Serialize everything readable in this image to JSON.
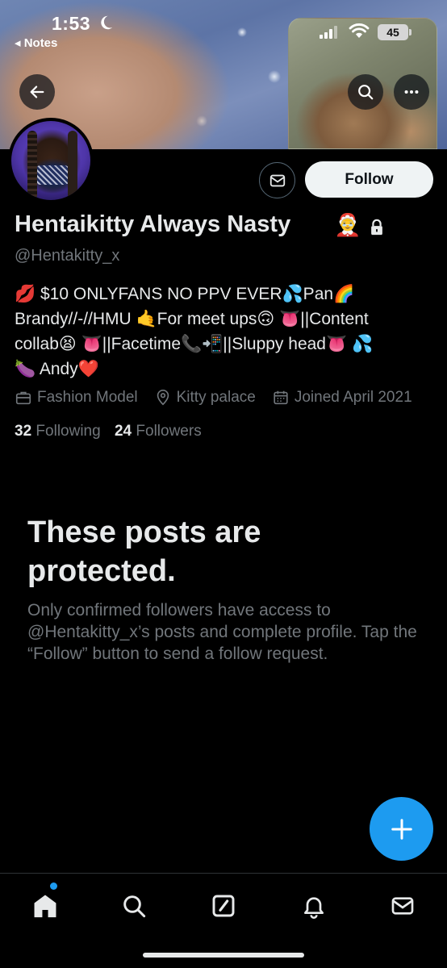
{
  "status_bar": {
    "time": "1:53",
    "back_app": "◂ Notes",
    "battery": "45"
  },
  "profile": {
    "display_name": "Hentaikitty Always Nasty",
    "name_emoji": "🤶",
    "handle": "@Hentakitty_x",
    "bio": "💋 $10 ONLYFANS NO PPV EVER💦Pan🌈\nBrandy//-//HMU 🤙For meet ups🙃 👅||Content\ncollab😫 👅||Facetime📞📲||Sluppy head👅 💦\n🍆 Andy❤️",
    "category": "Fashion Model",
    "location": "Kitty palace",
    "joined": "Joined April 2021",
    "following_count": "32",
    "following_label": "Following",
    "followers_count": "24",
    "followers_label": "Followers"
  },
  "actions": {
    "follow_label": "Follow"
  },
  "protected": {
    "title": "These posts are protected.",
    "description": "Only confirmed followers have access to @Hentakitty_x’s posts and complete profile. Tap the “Follow” button to send a follow request."
  },
  "colors": {
    "accent": "#1d9bf0",
    "muted": "#71767b",
    "text": "#e7e9ea"
  },
  "icons": [
    "back-arrow-icon",
    "search-icon",
    "more-icon",
    "mail-icon",
    "lock-icon",
    "briefcase-icon",
    "location-pin-icon",
    "calendar-icon",
    "plus-icon",
    "home-icon",
    "grok-icon",
    "bell-icon"
  ]
}
